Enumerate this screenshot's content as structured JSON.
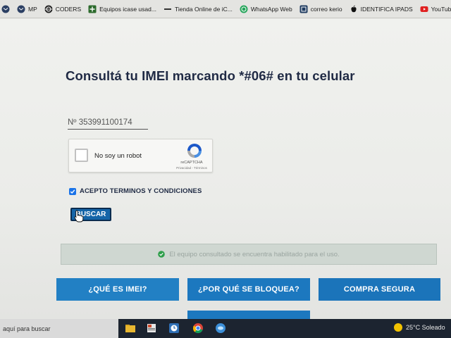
{
  "bookmarks": [
    {
      "label": "",
      "icon": "envelope-icon"
    },
    {
      "label": "MP",
      "icon": "envelope-icon"
    },
    {
      "label": "CODERS",
      "icon": "globe-icon"
    },
    {
      "label": "Equipos icase usad...",
      "icon": "plus-icon"
    },
    {
      "label": "Tienda Online de iC...",
      "icon": "dash-icon"
    },
    {
      "label": "WhatsApp Web",
      "icon": "whatsapp-icon"
    },
    {
      "label": "correo kerio",
      "icon": "mail-square-icon"
    },
    {
      "label": "IDENTIFICA IPADS",
      "icon": "apple-icon"
    },
    {
      "label": "YouTube",
      "icon": "youtube-icon"
    }
  ],
  "page": {
    "heading": "Consultá tu IMEI marcando *#06# en tu celular",
    "imei_value": "Nº 353991100174"
  },
  "captcha": {
    "label": "No soy un robot",
    "brand": "reCAPTCHA",
    "links": "Privacidad - Términos"
  },
  "terms": {
    "label": "ACEPTO TERMINOS Y CONDICIONES",
    "checked": true
  },
  "search_button": {
    "label": "BUSCAR"
  },
  "status": {
    "text": "El equipo consultado se encuentra habilitado para el uso.",
    "icon": "check-circle-icon",
    "color": "#2e9e4a"
  },
  "nav_buttons": [
    {
      "label": "¿QUÉ ES IMEI?"
    },
    {
      "label": "¿POR QUÉ SE BLOQUEA?"
    },
    {
      "label": "COMPRA SEGURA"
    }
  ],
  "taskbar": {
    "search_text": "aquí para buscar",
    "weather": "25°C  Soleado"
  },
  "colors": {
    "accent_blue": "#1d7cc3",
    "heading": "#1f2a44",
    "status_bg": "#cfd7d1"
  }
}
